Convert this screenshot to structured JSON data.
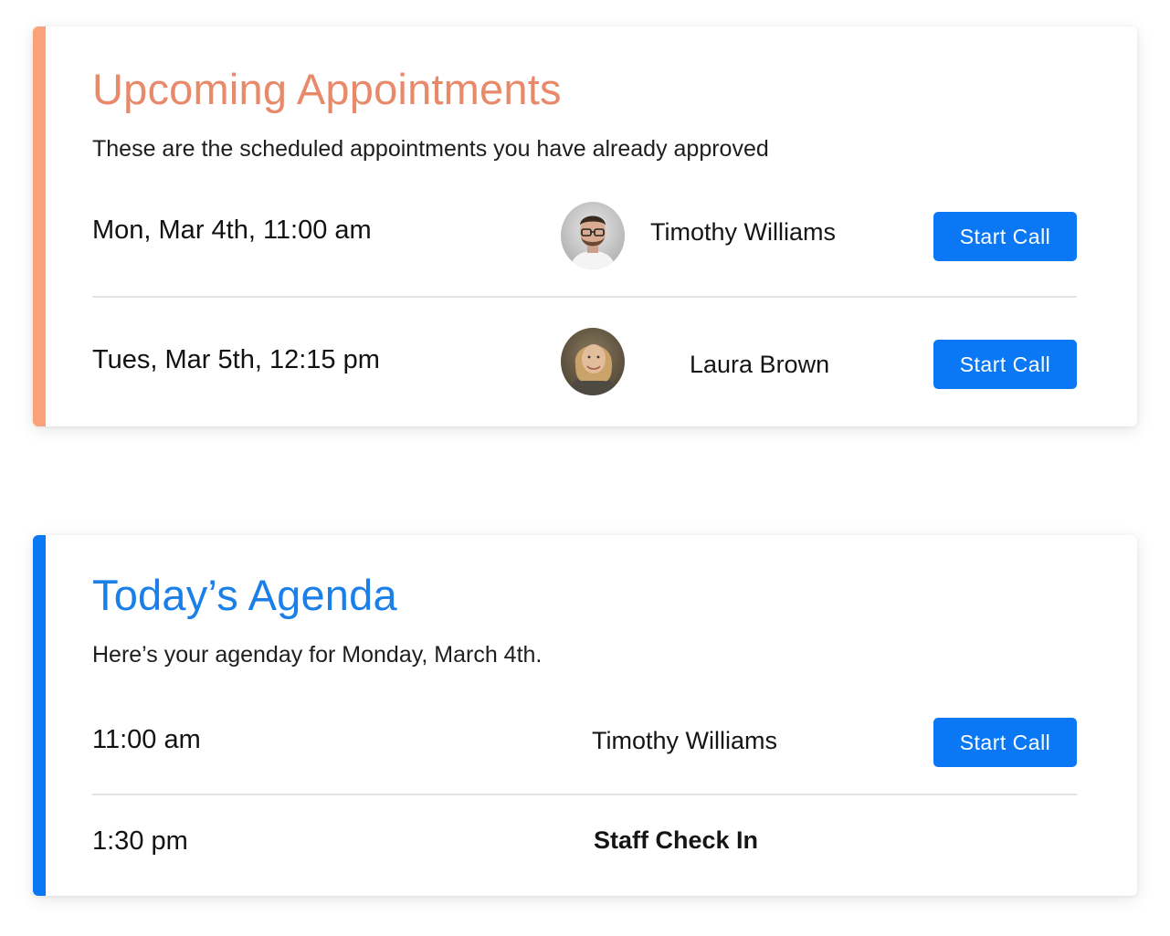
{
  "upcoming": {
    "title": "Upcoming Appointments",
    "subtitle": "These are the scheduled appointments you have already approved",
    "accent_color": "#f9a27a",
    "title_color": "#e8896a",
    "rows": [
      {
        "datetime": "Mon, Mar 4th, 11:00 am",
        "name": "Timothy Williams",
        "avatar": "man-avatar",
        "button": "Start Call"
      },
      {
        "datetime": "Tues, Mar 5th, 12:15 pm",
        "name": "Laura Brown",
        "avatar": "woman-avatar",
        "button": "Start Call"
      }
    ]
  },
  "agenda": {
    "title": "Today’s Agenda",
    "subtitle": "Here’s your agenday for Monday, March 4th.",
    "accent_color": "#0a78f5",
    "title_color": "#1a7fe8",
    "rows": [
      {
        "time": "11:00 am",
        "name": "Timothy Williams",
        "button": "Start Call"
      },
      {
        "time": "1:30 pm",
        "name": "Staff Check In"
      }
    ]
  },
  "button_color": "#0a78f5"
}
